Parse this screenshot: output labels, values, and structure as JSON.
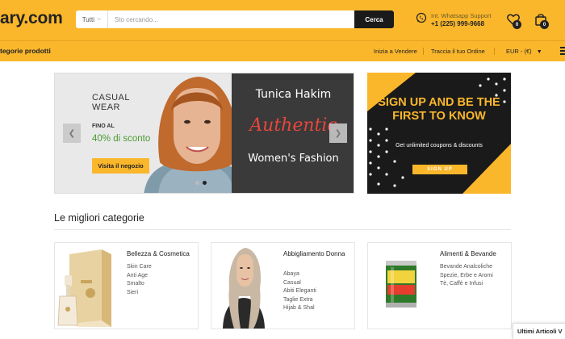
{
  "header": {
    "logo": "ary.com",
    "search": {
      "category": "Tutti",
      "placeholder": "Sto cercando...",
      "button_label": "Cerca"
    },
    "support": {
      "label": "Int. Whatsapp Support",
      "phone": "+1 (225) 999-9668"
    },
    "wishlist_count": "0",
    "cart_count": "0"
  },
  "nav": {
    "categories_label": "tegorie prodotti",
    "links": [
      "Inizia a Vendere",
      "Traccia il tuo Ordine"
    ],
    "currency": "EUR - (€)"
  },
  "hero": {
    "title": "CASUAL WEAR",
    "fino": "FINO AL",
    "discount": "40% di sconto",
    "cta": "Visita il negozio",
    "brand": "Tunica Hakim",
    "authentic": "Authentic",
    "tagline": "Women's Fashion",
    "active_slide": 2,
    "slide_count": 2
  },
  "promo": {
    "headline": "SIGN UP AND BE THE FIRST TO KNOW",
    "subtext": "Get unlimited coupons & discounts",
    "button": "SIGN UP"
  },
  "categories": {
    "title": "Le migliori categorie",
    "cards": [
      {
        "title": "Bellezza & Cosmetica",
        "items": [
          "Skin Care",
          "Anti Age",
          "Smalto",
          "Sieri"
        ]
      },
      {
        "title": "Abbigliamento Donna",
        "items": [
          "Abaya",
          "Casual",
          "Abiti Eleganti",
          "Taglie Extra",
          "Hijab & Shal"
        ]
      },
      {
        "title": "Alimenti & Bevande",
        "items": [
          "Bevande Analcoliche",
          "Spezie, Erbe e Aromi",
          "Tè, Caffè e Infusi"
        ]
      }
    ]
  },
  "recent_tab": "Ultimi Articoli V",
  "colors": {
    "brand": "#fbb72b",
    "dark": "#1a1a1a",
    "accent_green": "#4a9b2f",
    "accent_red": "#e8463d"
  }
}
